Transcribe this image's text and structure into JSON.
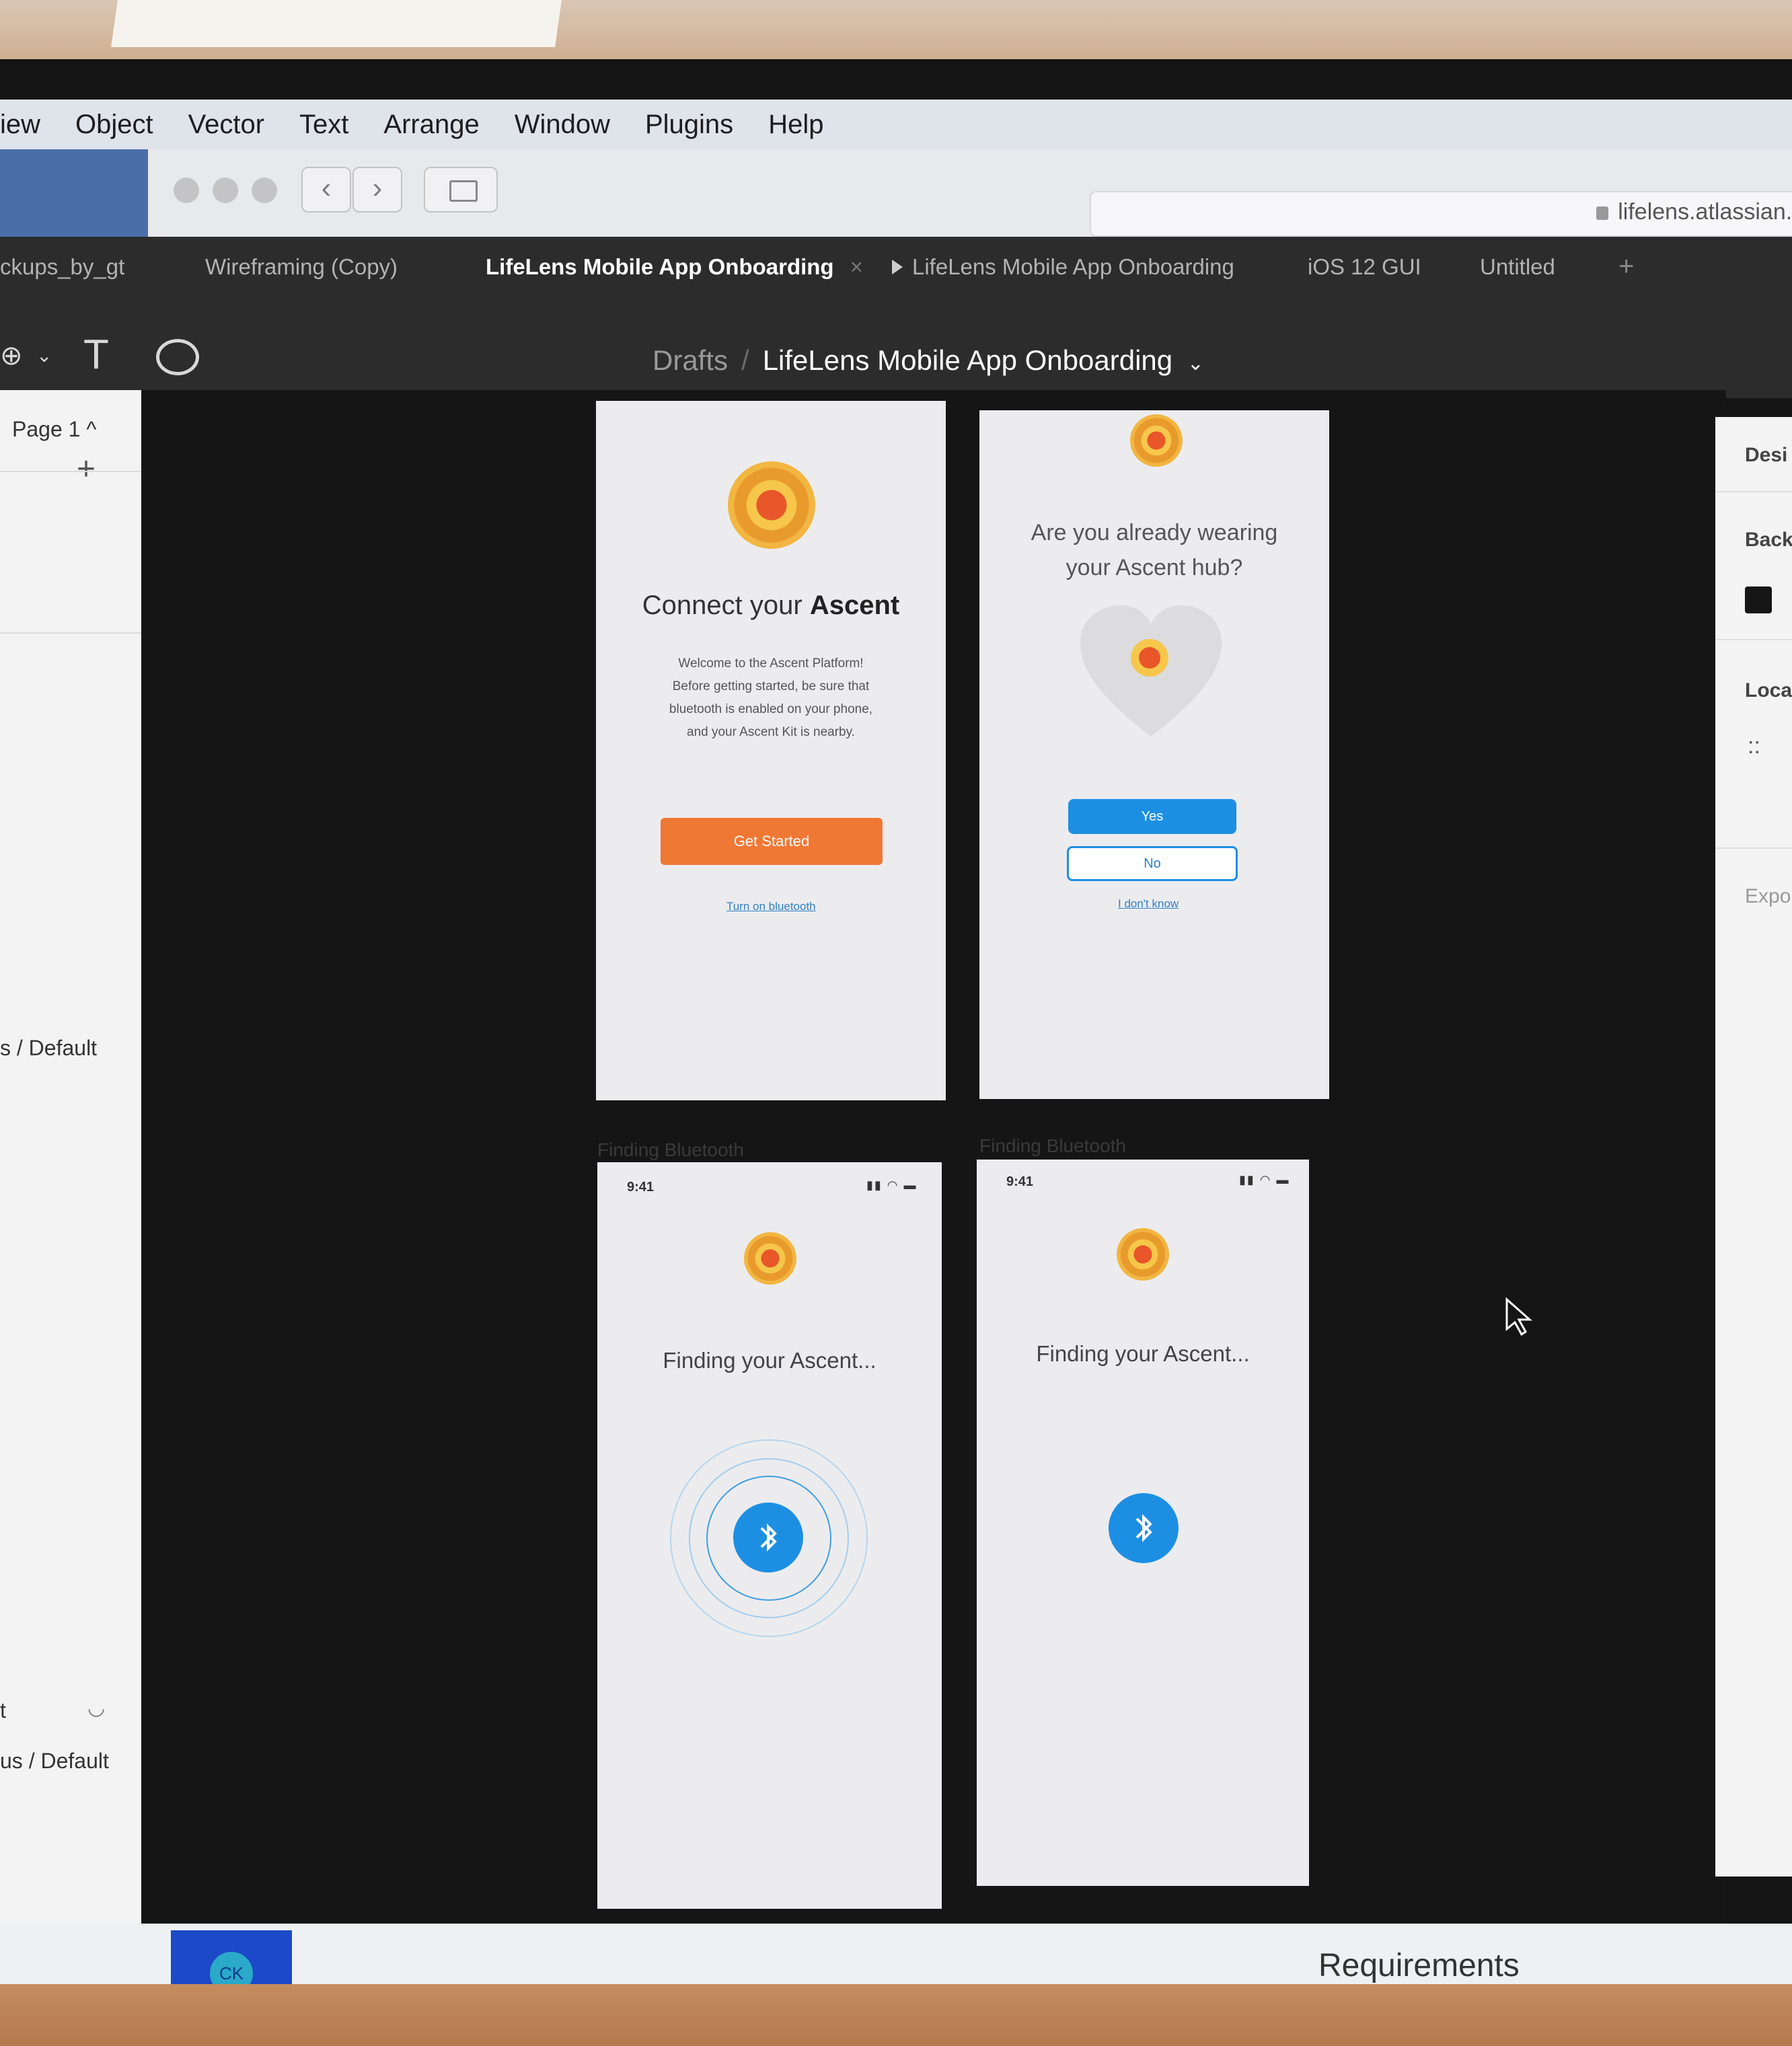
{
  "menu": {
    "items": [
      "iew",
      "Object",
      "Vector",
      "Text",
      "Arrange",
      "Window",
      "Plugins",
      "Help"
    ]
  },
  "browser": {
    "url": "lifelens.atlassian.ne"
  },
  "tabs": [
    {
      "label": "ckups_by_gt"
    },
    {
      "label": "Wireframing (Copy)"
    },
    {
      "label": "LifeLens Mobile App Onboarding",
      "close": "×"
    },
    {
      "label": "LifeLens Mobile App Onboarding"
    },
    {
      "label": "iOS 12 GUI"
    },
    {
      "label": "Untitled"
    }
  ],
  "tab_add": "+",
  "toolbar": {
    "breadcrumb_parent": "Drafts",
    "breadcrumb_sep": "/",
    "file_title": "LifeLens Mobile App Onboarding",
    "dropdown": "⌄",
    "text_tool": "T"
  },
  "left_panel": {
    "page_selector": "Page 1 ^",
    "add_page": "+",
    "layer1": "s / Default",
    "layer2": "t",
    "layer3": "us / Default"
  },
  "right_panel": {
    "design_tab": "Desi",
    "background": "Back",
    "local": "Local",
    "dots": "::",
    "export": "Expor"
  },
  "frames": {
    "connect": {
      "title_pre": "Connect your ",
      "title_bold": "Ascent",
      "body_line1": "Welcome to the Ascent Platform!",
      "body_line2": "Before getting started, be sure that",
      "body_line3": "bluetooth is enabled on your phone,",
      "body_line4": "and your Ascent Kit is nearby.",
      "button": "Get Started",
      "link": "Turn on bluetooth"
    },
    "wearing": {
      "question_line1": "Are you already wearing",
      "question_line2": "your Ascent hub?",
      "yes": "Yes",
      "no": "No",
      "link": "I don't know"
    },
    "finding1": {
      "label": "Finding Bluetooth",
      "time": "9:41",
      "status": "▮▮ ◠ ▬",
      "text": "Finding your Ascent..."
    },
    "finding2": {
      "label": "Finding Bluetooth",
      "time": "9:41",
      "status": "▮▮ ◠ ▬",
      "text": "Finding your Ascent..."
    }
  },
  "bottom": {
    "avatar": "CK",
    "requirements": "Requirements"
  },
  "colors": {
    "accent_orange": "#f07835",
    "accent_blue": "#1d8fe3",
    "logo_yellow": "#f2b641",
    "canvas_bg": "#151515"
  }
}
